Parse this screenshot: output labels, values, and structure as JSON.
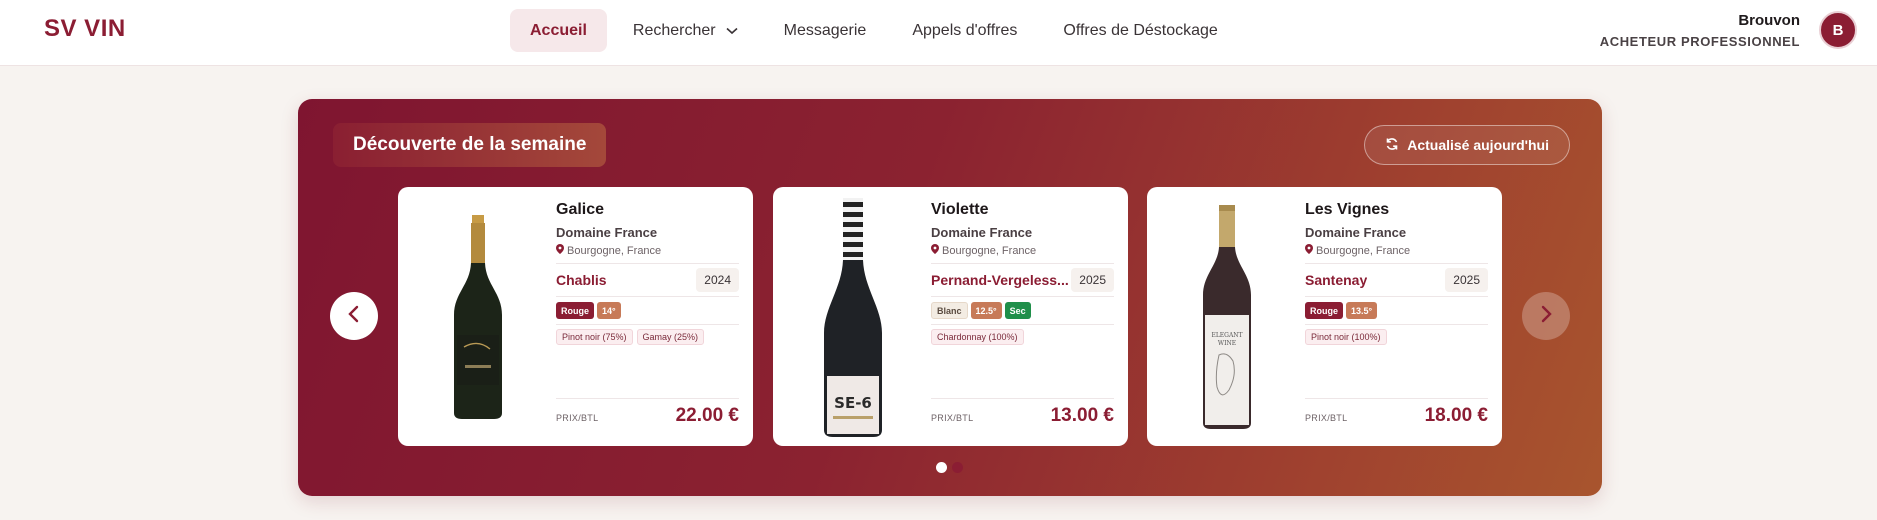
{
  "header": {
    "logo": "SV VIN",
    "nav": [
      {
        "label": "Accueil",
        "active": true
      },
      {
        "label": "Rechercher",
        "dropdown": true
      },
      {
        "label": "Messagerie"
      },
      {
        "label": "Appels d'offres"
      },
      {
        "label": "Offres de Déstockage"
      }
    ],
    "user": {
      "name": "Brouvon",
      "role": "ACHETEUR PROFESSIONNEL",
      "initial": "B"
    }
  },
  "banner": {
    "title": "Découverte de la semaine",
    "refresh_label": "Actualisé aujourd'hui",
    "price_label": "PRIX/BTL",
    "wines": [
      {
        "name": "Galice",
        "domain": "Domaine France",
        "region": "Bourgogne, France",
        "appellation": "Chablis",
        "year": "2024",
        "color": "Rouge",
        "degree": "14°",
        "style": "",
        "grapes": [
          "Pinot noir (75%)",
          "Gamay (25%)"
        ],
        "price": "22.00 €"
      },
      {
        "name": "Violette",
        "domain": "Domaine France",
        "region": "Bourgogne, France",
        "appellation": "Pernand-Vergeless...",
        "year": "2025",
        "color": "Blanc",
        "degree": "12.5°",
        "style": "Sec",
        "grapes": [
          "Chardonnay (100%)"
        ],
        "price": "13.00 €"
      },
      {
        "name": "Les Vignes",
        "domain": "Domaine France",
        "region": "Bourgogne, France",
        "appellation": "Santenay",
        "year": "2025",
        "color": "Rouge",
        "degree": "13.5°",
        "style": "",
        "grapes": [
          "Pinot noir (100%)"
        ],
        "price": "18.00 €"
      }
    ],
    "pagination": {
      "pages": 2,
      "current": 1
    }
  },
  "colors": {
    "accent": "#8b1d33",
    "background": "#f7f3f0"
  },
  "icons": [
    "refresh-icon",
    "chevron-left-icon",
    "chevron-right-icon",
    "map-pin-icon",
    "chevron-down-icon"
  ]
}
